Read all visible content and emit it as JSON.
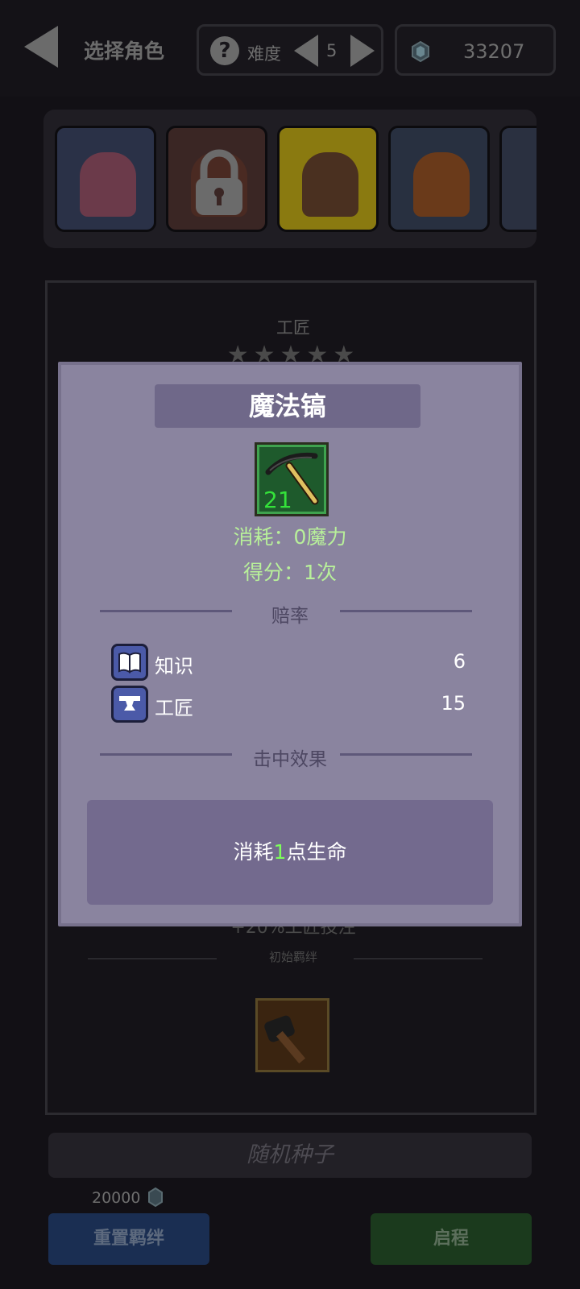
{
  "header": {
    "title": "选择角色",
    "difficulty_label": "难度",
    "difficulty_value": "5",
    "help_glyph": "?",
    "gems": "33207"
  },
  "characters": [
    {
      "name": "red-hair",
      "locked": false
    },
    {
      "name": "locked-hero",
      "locked": true
    },
    {
      "name": "bald-monk",
      "locked": false
    },
    {
      "name": "orange-hair",
      "locked": false
    }
  ],
  "background": {
    "class_name": "工匠",
    "stars": "★★★★★",
    "bonus_text": "+20%工匠投注",
    "initial_bond_label": "初始羁绊"
  },
  "seed": {
    "placeholder": "随机种子"
  },
  "reset": {
    "cost": "20000",
    "label": "重置羁绊"
  },
  "start": {
    "label": "启程"
  },
  "popup": {
    "title": "魔法镐",
    "item_level": "21",
    "cost_line": "消耗：0魔力",
    "score_line": "得分：1次",
    "odds_header": "赔率",
    "odds": [
      {
        "icon": "book-icon",
        "name": "知识",
        "value": "6"
      },
      {
        "icon": "anvil-icon",
        "name": "工匠",
        "value": "15"
      }
    ],
    "effect_header": "击中效果",
    "effect_prefix": "消耗",
    "effect_number": "1",
    "effect_suffix": "点生命"
  },
  "colors": {
    "popup_bg": "#8a849f",
    "title_bar": "#6f6889",
    "stat_green": "#b8f09a",
    "highlight_green": "#7dff5a",
    "odds_icon_bg": "#4b5aa8"
  }
}
